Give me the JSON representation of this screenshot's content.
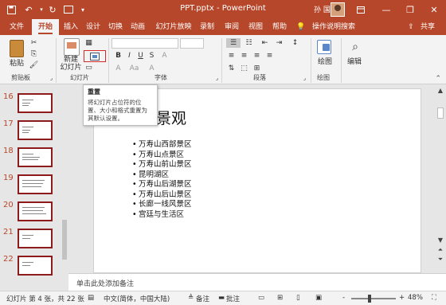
{
  "titlebar": {
    "title": "PPT.pptx - PowerPoint",
    "user": "孙 国庆",
    "save_icon": "save-icon",
    "undo_icon": "undo-icon",
    "redo_icon": "redo-icon",
    "start_icon": "present-from-start-icon",
    "customize_icon": "customize-qat-icon"
  },
  "tabs": [
    "文件",
    "开始",
    "插入",
    "设计",
    "切换",
    "动画",
    "幻灯片放映",
    "录制",
    "审阅",
    "视图",
    "帮助",
    "操作说明搜索",
    "共享"
  ],
  "ribbon": {
    "paste_label": "粘贴",
    "clipboard_label": "剪贴板",
    "new_slide_label": "新建\n幻灯片",
    "slides_label": "幻灯片",
    "font_label": "字体",
    "paragraph_label": "段落",
    "drawing_label": "绘图",
    "editing_label": "编辑",
    "font_buttons": [
      "B",
      "I",
      "U",
      "S",
      "A",
      "Aa",
      "A"
    ],
    "para_buttons": [
      "≡",
      "≡",
      "≡",
      "≡"
    ]
  },
  "tooltip": {
    "title": "重置",
    "body": "将幻灯片占位符的位置、大小和格式重置为其默认设置。"
  },
  "thumbnails": {
    "numbers": [
      "16",
      "17",
      "18",
      "19",
      "20",
      "21",
      "22"
    ]
  },
  "slide": {
    "title": "景观",
    "bullets": [
      "万寿山西部景区",
      "万寿山点景区",
      "万寿山前山景区",
      "昆明湖区",
      "万寿山后湖景区",
      "万寿山后山景区",
      "长廊一线风景区",
      "宫廷与生活区"
    ]
  },
  "notes": {
    "placeholder": "单击此处添加备注"
  },
  "status": {
    "slide_info": "幻灯片 第 4 张，共 22 张",
    "language": "中文(简体，中国大陆)",
    "notes_label": "备注",
    "comments_label": "批注",
    "zoom": "48%",
    "minus": "-",
    "plus": "+"
  }
}
